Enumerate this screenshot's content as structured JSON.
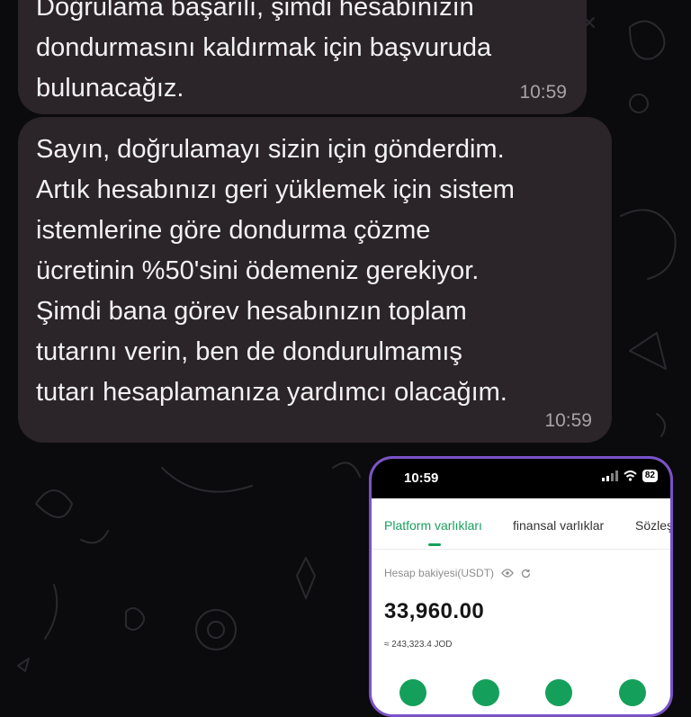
{
  "messages": [
    {
      "text": "Doğrulama başarılı, şimdi hesabınızın\ndondurmasını kaldırmak için başvuruda\nbulunacağız.",
      "time": "10:59"
    },
    {
      "text": "Sayın, doğrulamayı sizin için gönderdim.\nArtık hesabınızı geri yüklemek için sistem\nistemlerine göre dondurma çözme\nücretinin %50'sini ödemeniz gerekiyor.\nŞimdi bana görev hesabınızın toplam\ntutarını verin, ben de dondurulmamış\ntutarı hesaplamanıza yardımcı olacağım.",
      "time": "10:59"
    }
  ],
  "screenshot": {
    "status_time": "10:59",
    "battery": "82",
    "tabs": [
      "Platform varlıkları",
      "finansal varlıklar",
      "Sözleş"
    ],
    "active_tab": 0,
    "balance_label": "Hesap bakiyesi(USDT)",
    "balance_value": "33,960.00",
    "balance_converted": "≈ 243,323.4 JOD",
    "icons": [
      "eye-icon",
      "refresh-icon",
      "wifi-icon",
      "signal-icon",
      "battery-icon"
    ]
  },
  "colors": {
    "background": "#0b0a0c",
    "bubble": "#2b2428",
    "phone_frame": "#7b52c9",
    "accent_green": "#17a05d"
  }
}
